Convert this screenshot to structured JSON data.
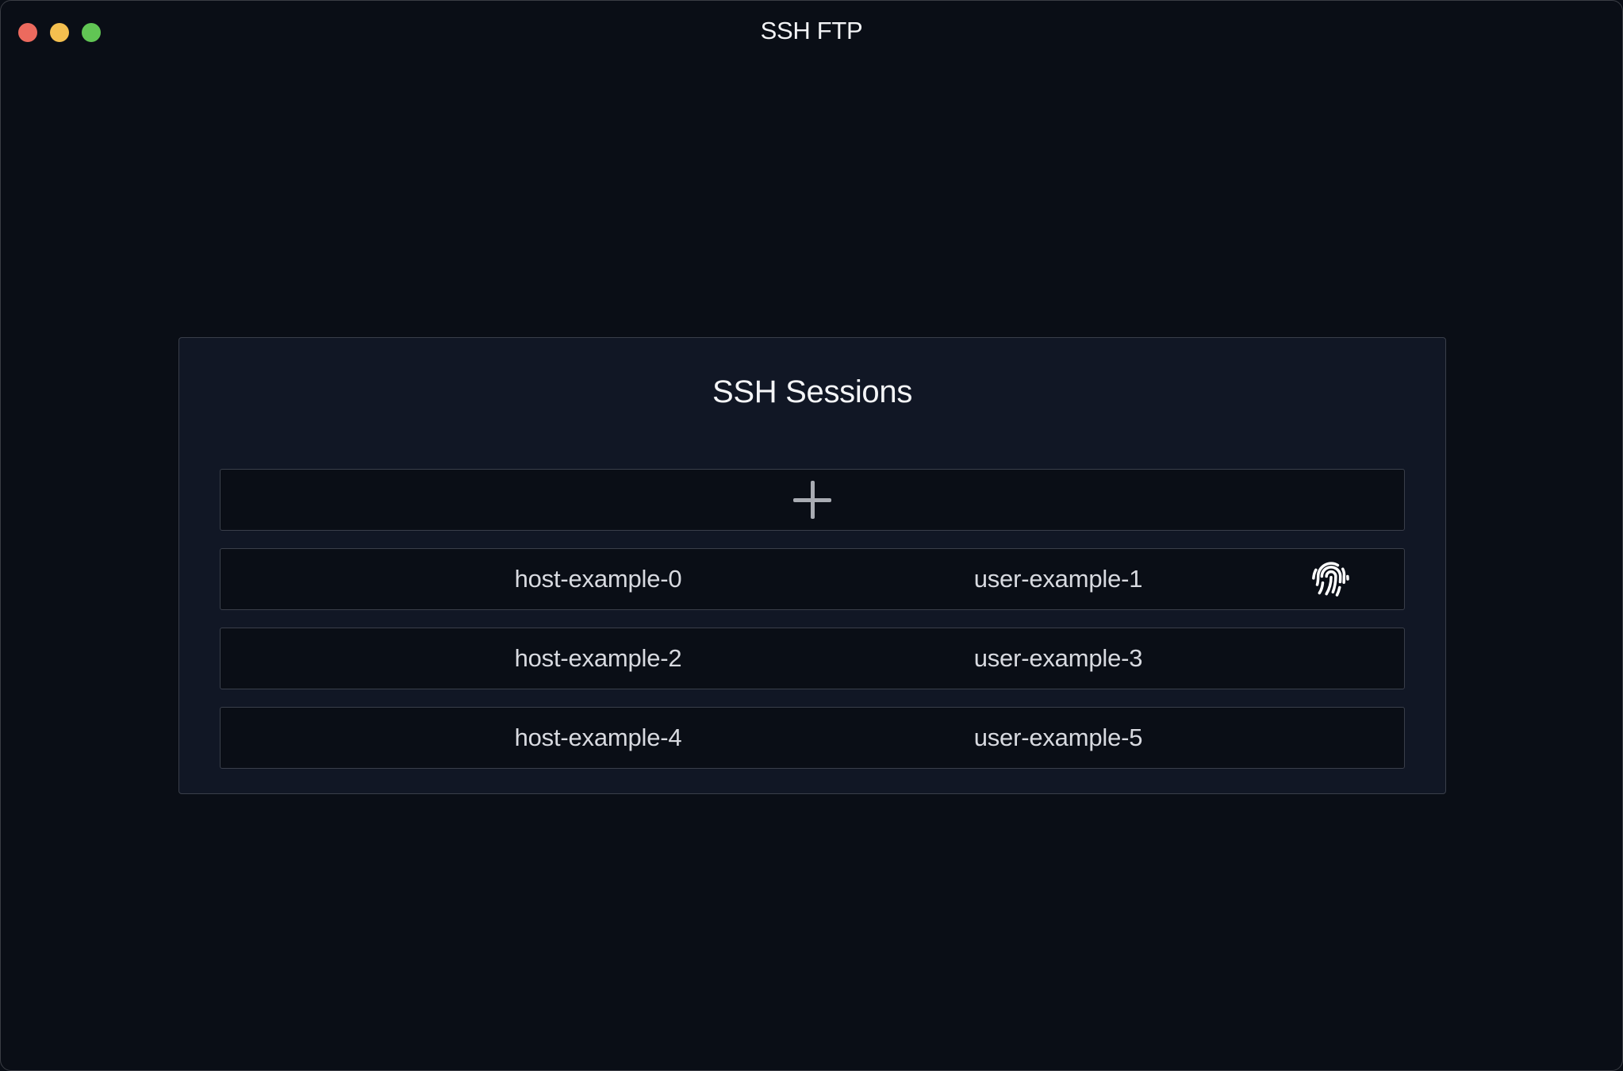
{
  "window": {
    "title": "SSH FTP",
    "controls": {
      "close_color": "#ec6a5e",
      "minimize_color": "#f4bf4f",
      "maximize_color": "#61c554"
    }
  },
  "panel": {
    "title": "SSH Sessions",
    "add_button_icon": "plus-icon",
    "sessions": [
      {
        "host": "host-example-0",
        "user": "user-example-1",
        "icon": "fingerprint-icon"
      },
      {
        "host": "host-example-2",
        "user": "user-example-3"
      },
      {
        "host": "host-example-4",
        "user": "user-example-5"
      }
    ]
  },
  "colors": {
    "background": "#0a0e16",
    "panel": "#111725",
    "border": "#3a3f4a",
    "text": "#d8dae0"
  }
}
